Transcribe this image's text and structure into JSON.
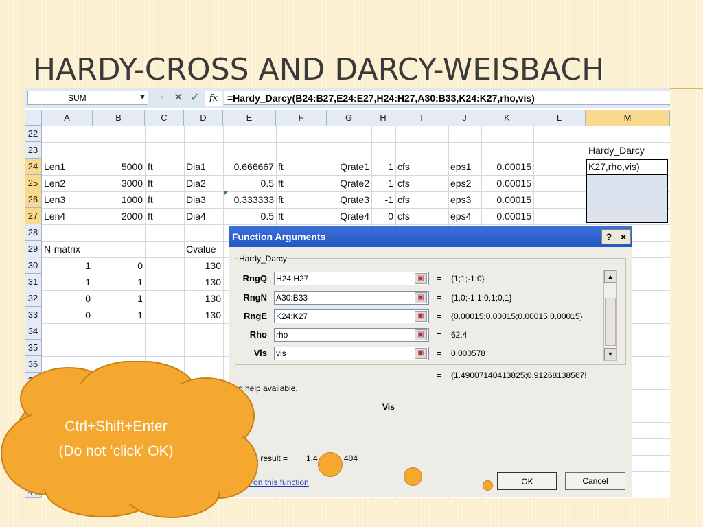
{
  "slide": {
    "title": "HARDY-CROSS AND DARCY-WEISBACH"
  },
  "excel": {
    "namebox": "SUM",
    "formula": "=Hardy_Darcy(B24:B27,E24:E27,H24:H27,A30:B33,K24:K27,rho,vis)",
    "columns": [
      "A",
      "B",
      "C",
      "D",
      "E",
      "F",
      "G",
      "H",
      "I",
      "J",
      "K",
      "L",
      "M"
    ],
    "rows": [
      "22",
      "23",
      "24",
      "25",
      "26",
      "27",
      "28",
      "29",
      "30",
      "31",
      "32",
      "33",
      "34",
      "35",
      "36",
      "37",
      "44"
    ],
    "cells": {
      "m23": "Hardy_Darcy",
      "m24": "K27,rho,vis)",
      "r24": [
        "Len1",
        "5000",
        "ft",
        "Dia1",
        "0.666667",
        "ft",
        "Qrate1",
        "1",
        "cfs",
        "eps1",
        "0.00015"
      ],
      "r25": [
        "Len2",
        "3000",
        "ft",
        "Dia2",
        "0.5",
        "ft",
        "Qrate2",
        "1",
        "cfs",
        "eps2",
        "0.00015"
      ],
      "r26": [
        "Len3",
        "1000",
        "ft",
        "Dia3",
        "0.333333",
        "ft",
        "Qrate3",
        "-1",
        "cfs",
        "eps3",
        "0.00015"
      ],
      "r27": [
        "Len4",
        "2000",
        "ft",
        "Dia4",
        "0.5",
        "ft",
        "Qrate4",
        "0",
        "cfs",
        "eps4",
        "0.00015"
      ],
      "r29": [
        "N-matrix",
        "Cvalue"
      ],
      "r30": [
        "1",
        "0",
        "130"
      ],
      "r31": [
        "-1",
        "1",
        "130"
      ],
      "r32": [
        "0",
        "1",
        "130"
      ],
      "r33": [
        "0",
        "1",
        "130"
      ]
    }
  },
  "dialog": {
    "title": "Function Arguments",
    "help_btn": "?",
    "close_btn": "×",
    "group_label": "Hardy_Darcy",
    "args": [
      {
        "label": "RngQ",
        "value": "H24:H27",
        "result": "{1;1;-1;0}"
      },
      {
        "label": "RngN",
        "value": "A30:B33",
        "result": "{1,0;-1,1;0,1;0,1}"
      },
      {
        "label": "RngE",
        "value": "K24:K27",
        "result": "{0.00015;0.00015;0.00015;0.00015}"
      },
      {
        "label": "Rho",
        "value": "rho",
        "result": "62.4"
      },
      {
        "label": "Vis",
        "value": "vis",
        "result": "0.000578"
      }
    ],
    "eq": "=",
    "total_result": "{1.49007140413825;0.91268138567!",
    "help_text": "o help available.",
    "arg_name": "Vis",
    "formula_result_label": "mula result =",
    "formula_result_value": "1.4",
    "formula_result_tail": "404",
    "help_link": "Help on this function",
    "ok": "OK",
    "cancel": "Cancel"
  },
  "callout": {
    "line1": "Ctrl+Shift+Enter",
    "line2": "(Do not ‘click’ OK)",
    "color": "#f5a830"
  }
}
